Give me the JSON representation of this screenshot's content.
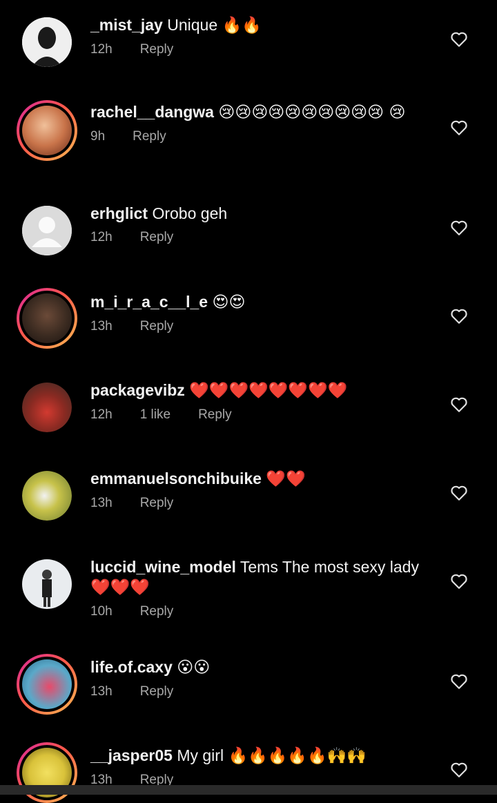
{
  "comments": [
    {
      "username": "_mist_jay",
      "text": "Unique",
      "emoji": "🔥🔥",
      "time": "12h",
      "likes": "",
      "reply": "Reply",
      "avatar_color": "#e8e8e8",
      "ring": false
    },
    {
      "username": "rachel__dangwa",
      "text": "",
      "emoji": "😢😢😢😢😢😢😢😢😢😢 😢",
      "time": "9h",
      "likes": "",
      "reply": "Reply",
      "avatar_color": "#c9744a",
      "ring": true
    },
    {
      "username": "erhglict",
      "text": "Orobo geh",
      "emoji": "",
      "time": "12h",
      "likes": "",
      "reply": "Reply",
      "avatar_color": "#d8d8d8",
      "ring": false
    },
    {
      "username": "m_i_r_a_c__l_e",
      "text": "",
      "emoji": "😍😍",
      "time": "13h",
      "likes": "",
      "reply": "Reply",
      "avatar_color": "#3a2a20",
      "ring": true
    },
    {
      "username": "packagevibz",
      "text": "",
      "emoji": "❤️❤️❤️❤️❤️❤️❤️❤️",
      "time": "12h",
      "likes": "1 like",
      "reply": "Reply",
      "avatar_color": "#b0302a",
      "ring": false
    },
    {
      "username": "emmanuelsonchibuike",
      "text": "",
      "emoji": "❤️❤️",
      "time": "13h",
      "likes": "",
      "reply": "Reply",
      "avatar_color": "#c7c24a",
      "ring": false
    },
    {
      "username": "luccid_wine_model",
      "text": "Tems The most sexy lady",
      "emoji": "❤️❤️❤️",
      "time": "10h",
      "likes": "",
      "reply": "Reply",
      "avatar_color": "#dfe3e6",
      "ring": false
    },
    {
      "username": "life.of.caxy",
      "text": "",
      "emoji": "😮😮",
      "time": "13h",
      "likes": "",
      "reply": "Reply",
      "avatar_color": "#5aa9c9",
      "ring": true
    },
    {
      "username": "__jasper05",
      "text": "My girl",
      "emoji": "🔥🔥🔥🔥🔥🙌🙌",
      "time": "13h",
      "likes": "",
      "reply": "Reply",
      "avatar_color": "#d9c23a",
      "ring": true
    }
  ],
  "icons": {
    "like": "heart-outline-icon"
  }
}
